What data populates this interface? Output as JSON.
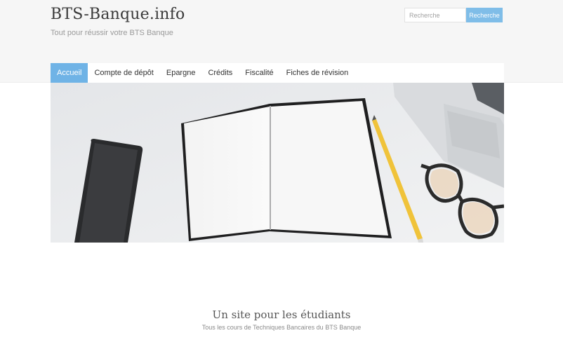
{
  "header": {
    "site_title": "BTS-Banque.info",
    "tagline": "Tout pour réussir votre BTS Banque"
  },
  "search": {
    "placeholder": "Recherche",
    "button_label": "Recherche"
  },
  "nav": {
    "items": [
      {
        "label": "Accueil",
        "active": true
      },
      {
        "label": "Compte de dépôt",
        "active": false
      },
      {
        "label": "Epargne",
        "active": false
      },
      {
        "label": "Crédits",
        "active": false
      },
      {
        "label": "Fiscalité",
        "active": false
      },
      {
        "label": "Fiches de révision",
        "active": false
      }
    ]
  },
  "hero": {
    "image_subject": "desk-with-phone-notebook-pencil-glasses-laptop"
  },
  "section": {
    "title": "Un site pour les étudiants",
    "subtitle": "Tous les cours de Techniques Bancaires du BTS Banque"
  },
  "colors": {
    "accent": "#6fb3e6",
    "button": "#7fbde8",
    "header_bg": "#f6f6f6"
  }
}
